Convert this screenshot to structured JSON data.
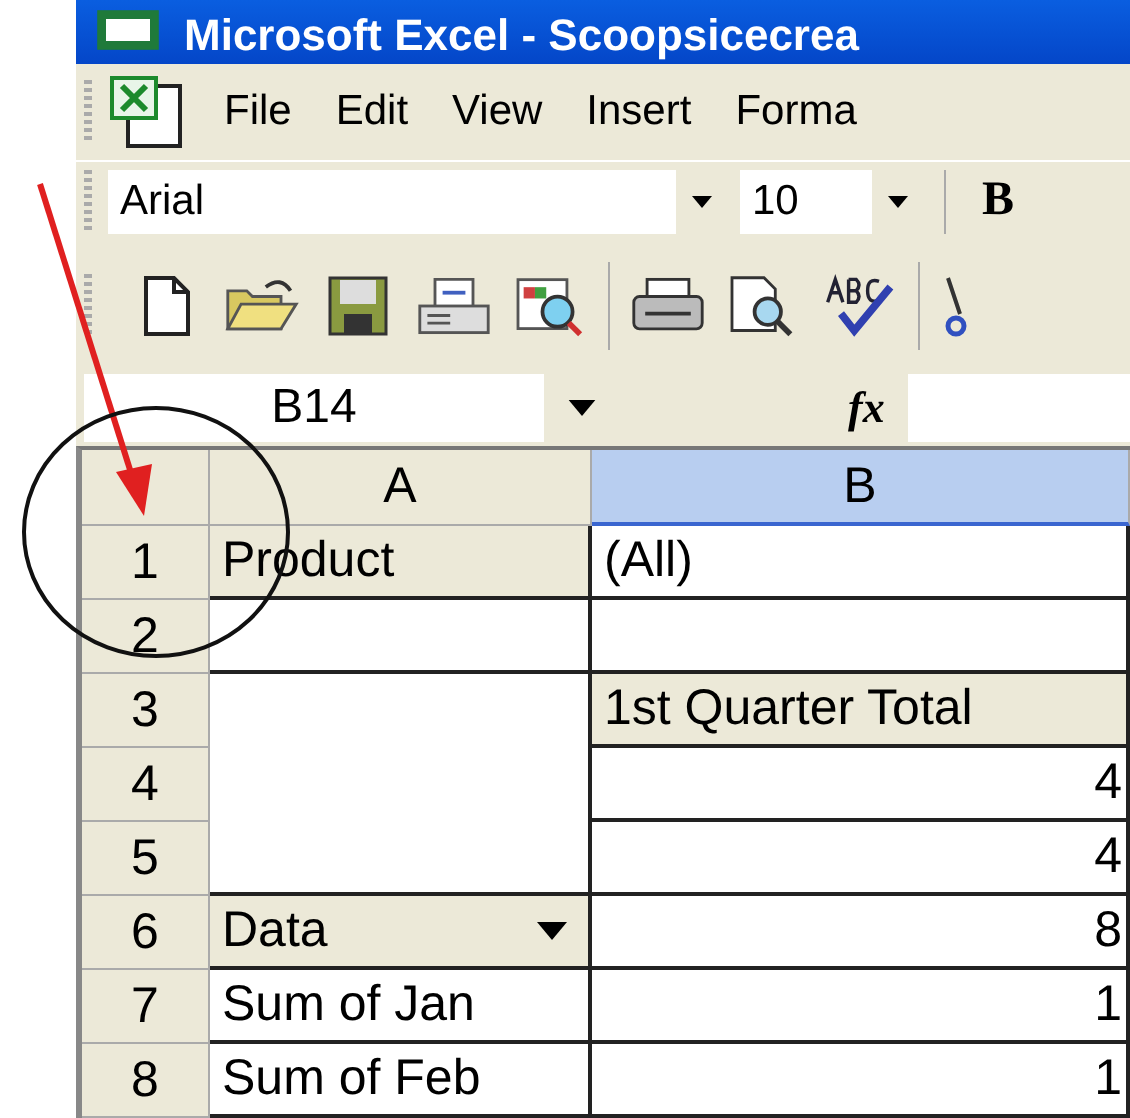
{
  "window": {
    "title": "Microsoft Excel - Scoopsicecrea"
  },
  "menu": [
    "File",
    "Edit",
    "View",
    "Insert",
    "Forma"
  ],
  "formatting_toolbar": {
    "font": "Arial",
    "size": "10",
    "bold": "B"
  },
  "formula_bar": {
    "name_box": "B14",
    "function_label": "fx"
  },
  "columns": [
    {
      "label": "A",
      "selected": false
    },
    {
      "label": "B",
      "selected": true
    }
  ],
  "rows": [
    {
      "number": "1",
      "cells": [
        {
          "kind": "field",
          "text": "Product",
          "dropdown": false
        },
        {
          "kind": "value",
          "text": "(All)"
        }
      ]
    },
    {
      "number": "2",
      "cells": [
        {
          "kind": "blank"
        },
        {
          "kind": "blank"
        }
      ]
    },
    {
      "number": "3",
      "cells": [
        {
          "kind": "open"
        },
        {
          "kind": "field",
          "text": "1st Quarter Total",
          "dropdown": false
        }
      ]
    },
    {
      "number": "4",
      "cells": [
        {
          "kind": "open"
        },
        {
          "kind": "number",
          "text": "4"
        }
      ]
    },
    {
      "number": "5",
      "cells": [
        {
          "kind": "blank"
        },
        {
          "kind": "number",
          "text": "4"
        }
      ]
    },
    {
      "number": "6",
      "cells": [
        {
          "kind": "field",
          "text": "Data",
          "dropdown": true
        },
        {
          "kind": "number",
          "text": "8"
        }
      ]
    },
    {
      "number": "7",
      "cells": [
        {
          "kind": "value",
          "text": "Sum of Jan"
        },
        {
          "kind": "number",
          "text": "1"
        }
      ]
    },
    {
      "number": "8",
      "cells": [
        {
          "kind": "value",
          "text": "Sum of Feb"
        },
        {
          "kind": "number",
          "text": "1"
        }
      ]
    }
  ]
}
